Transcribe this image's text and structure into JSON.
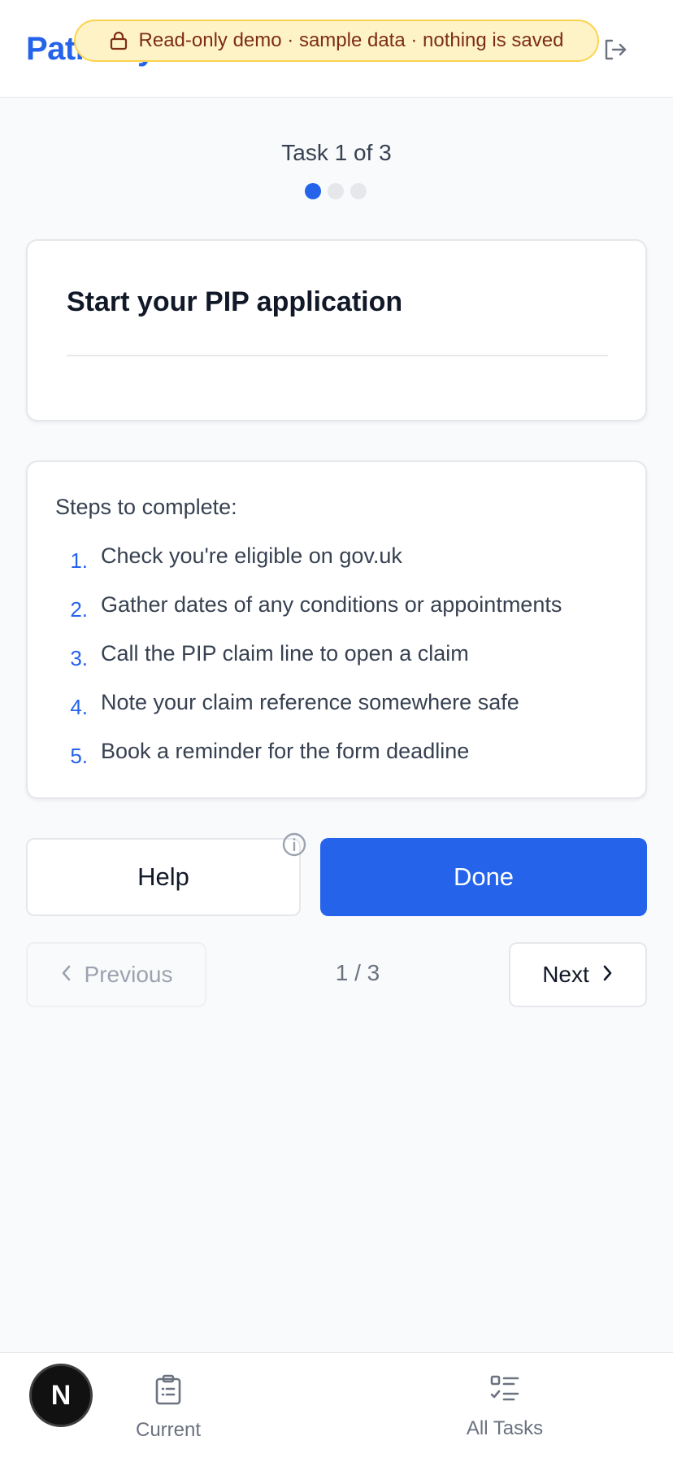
{
  "header": {
    "brand": "Pathway",
    "banner_text": "Read-only demo · sample data · nothing is saved",
    "lock_icon": "lock-icon",
    "logout_icon": "logout-icon"
  },
  "progress": {
    "counter_text": "Task 1 of 3",
    "current": 1,
    "total": 3
  },
  "task": {
    "title": "Start your PIP application"
  },
  "steps": {
    "heading": "Steps to complete:",
    "items": [
      {
        "num": "1.",
        "text": "Check you're eligible on gov.uk"
      },
      {
        "num": "2.",
        "text": "Gather dates of any conditions or appointments"
      },
      {
        "num": "3.",
        "text": "Call the PIP claim line to open a claim"
      },
      {
        "num": "4.",
        "text": "Note your claim reference somewhere safe"
      },
      {
        "num": "5.",
        "text": "Book a reminder for the form deadline"
      }
    ]
  },
  "actions": {
    "help_label": "Help",
    "done_label": "Done",
    "info_icon": "info-icon"
  },
  "pagination": {
    "prev_label": "Previous",
    "next_label": "Next",
    "page_text": "1 / 3"
  },
  "bottom_nav": {
    "current_label": "Current",
    "all_tasks_label": "All Tasks",
    "badge_letter": "N"
  },
  "colors": {
    "accent": "#2563eb",
    "banner_bg": "#fef3c7",
    "banner_text": "#7c2d12"
  }
}
